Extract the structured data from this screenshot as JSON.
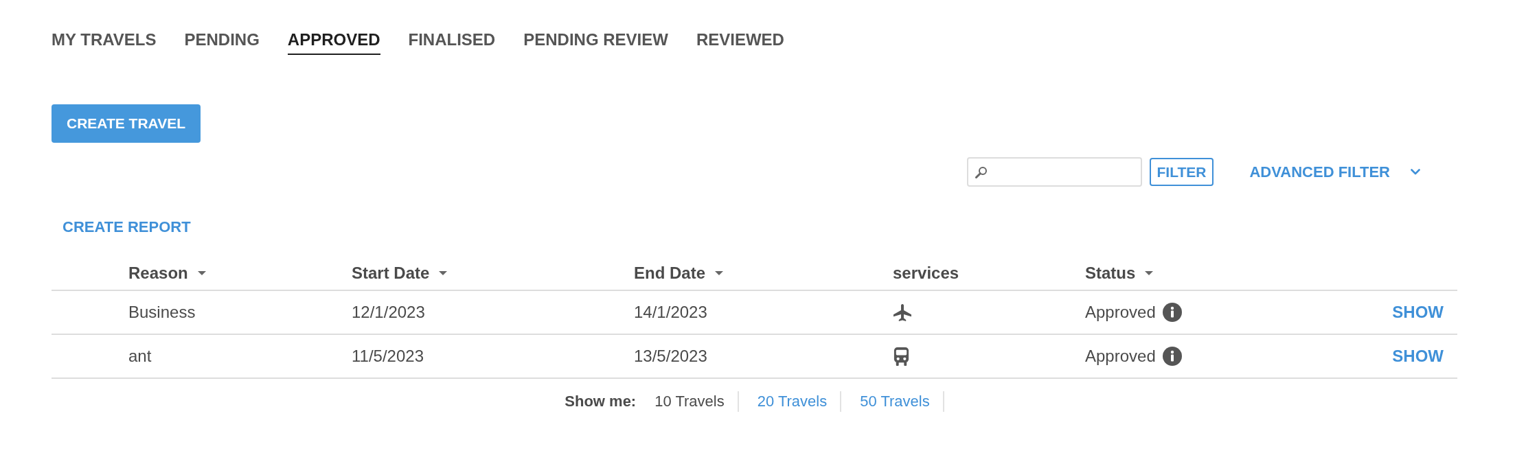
{
  "tabs": [
    {
      "label": "MY TRAVELS",
      "selected": false
    },
    {
      "label": "PENDING",
      "selected": false
    },
    {
      "label": "APPROVED",
      "selected": true
    },
    {
      "label": "FINALISED",
      "selected": false
    },
    {
      "label": "PENDING REVIEW",
      "selected": false
    },
    {
      "label": "REVIEWED",
      "selected": false
    }
  ],
  "create_travel_button": {
    "label": "CREATE TRAVEL"
  },
  "filter_bar": {
    "filter_button": {
      "label": "FILTER"
    },
    "advanced_filter": {
      "label": "ADVANCED FILTER",
      "expanded": false
    }
  },
  "create_report_link": {
    "label": "CREATE REPORT"
  },
  "table": {
    "columns": [
      {
        "label": "Reason",
        "sortable": true
      },
      {
        "label": "Start Date",
        "sortable": true
      },
      {
        "label": "End Date",
        "sortable": true
      },
      {
        "label": "services",
        "sortable": false
      },
      {
        "label": "Status",
        "sortable": true
      }
    ],
    "rows": [
      {
        "reason": "Business",
        "start_date": "12/1/2023",
        "end_date": "14/1/2023",
        "service": {
          "kind": "flight"
        },
        "status": "Approved",
        "action": "SHOW"
      },
      {
        "reason": "ant",
        "start_date": "11/5/2023",
        "end_date": "13/5/2023",
        "service": {
          "kind": "train"
        },
        "status": "Approved",
        "action": "SHOW"
      }
    ]
  },
  "pagination": {
    "label": "Show me:",
    "options": [
      {
        "label": "10 Travels",
        "selected": true
      },
      {
        "label": "20 Travels",
        "selected": false
      },
      {
        "label": "50 Travels",
        "selected": false
      }
    ]
  }
}
